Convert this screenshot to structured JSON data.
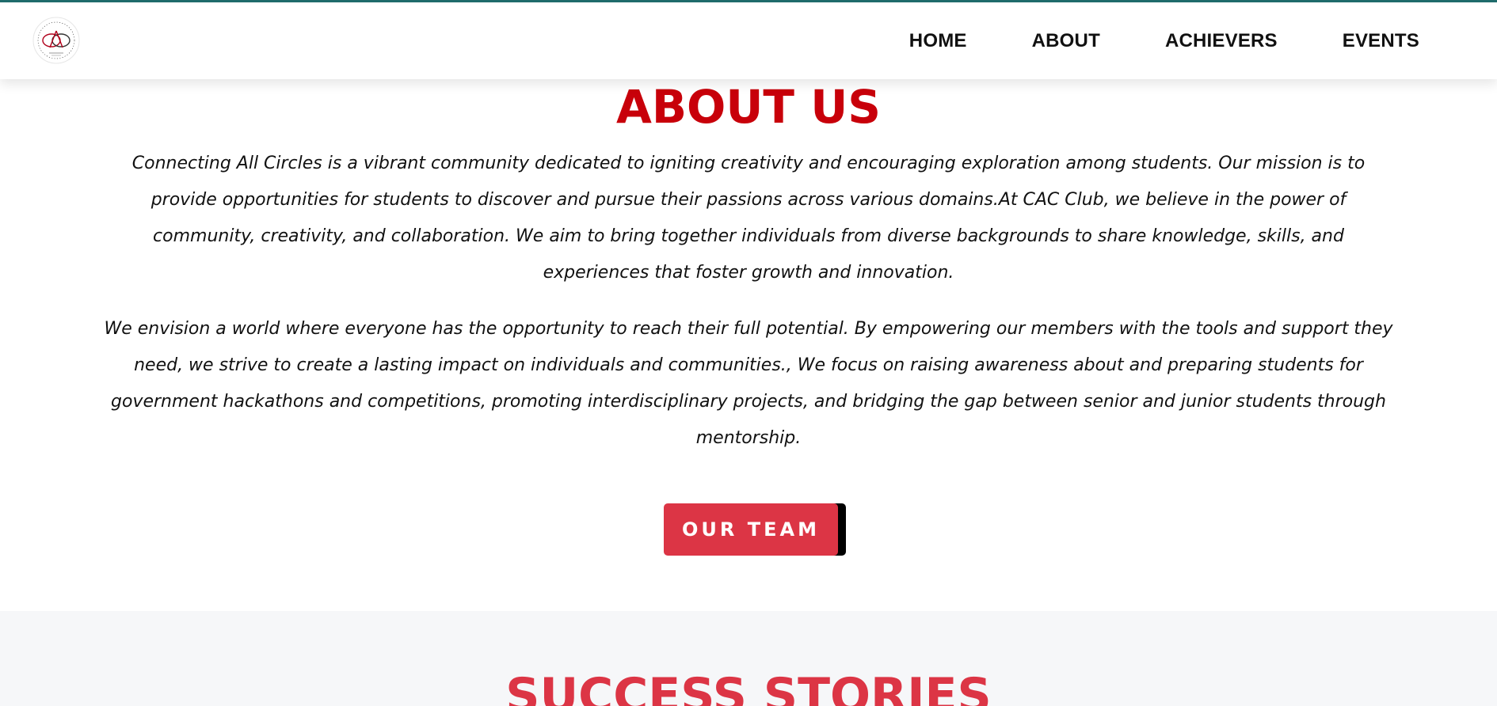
{
  "nav": {
    "logo_alt": "Connecting All Circles logo",
    "items": [
      {
        "label": "HOME"
      },
      {
        "label": "ABOUT"
      },
      {
        "label": "ACHIEVERS"
      },
      {
        "label": "EVENTS"
      }
    ]
  },
  "about": {
    "title": "ABOUT US",
    "paragraph1": "Connecting All Circles is a vibrant community dedicated to igniting creativity and encouraging exploration among students. Our mission is to provide opportunities for students to discover and pursue their passions across various domains.At CAC Club, we believe in the power of community, creativity, and collaboration. We aim to bring together individuals from diverse backgrounds to share knowledge, skills, and experiences that foster growth and innovation.",
    "paragraph2": "We envision a world where everyone has the opportunity to reach their full potential. By empowering our members with the tools and support they need, we strive to create a lasting impact on individuals and communities., We focus on raising awareness about and preparing students for government hackathons and competitions, promoting interdisciplinary projects, and bridging the gap between senior and junior students through mentorship.",
    "button_label": "OUR TEAM"
  },
  "stories": {
    "title": "SUCCESS STORIES"
  },
  "colors": {
    "accent_red": "#c8000a",
    "button_red": "#dc3545",
    "top_stripe": "#1f6b6b"
  }
}
